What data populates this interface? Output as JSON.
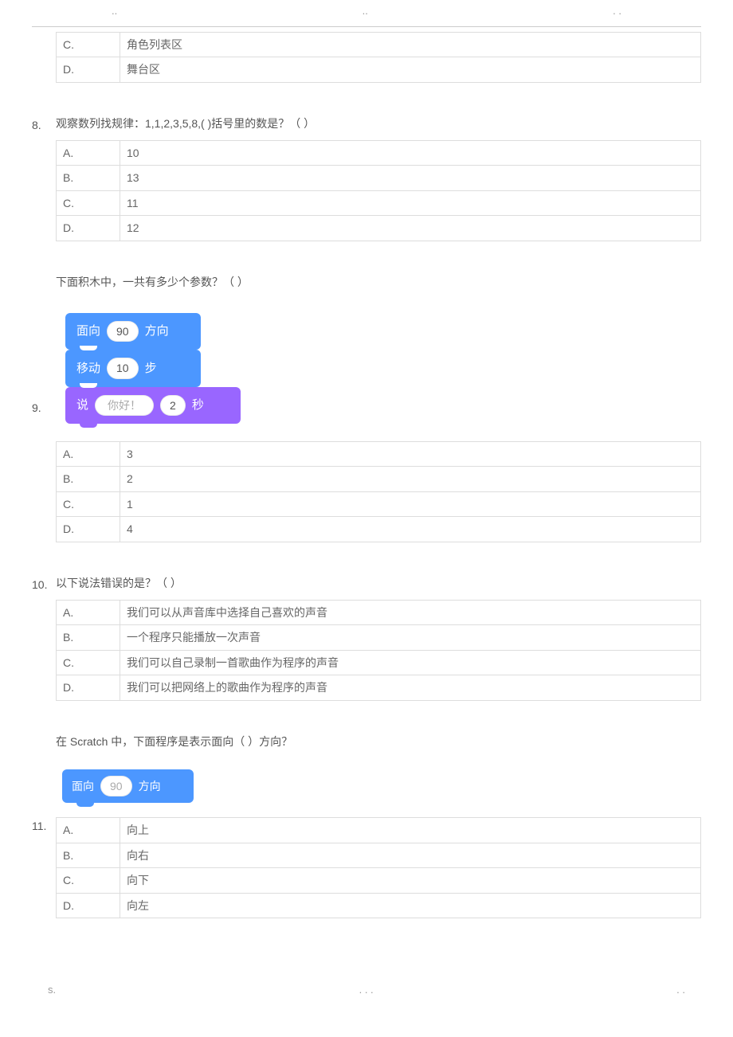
{
  "topdots": {
    "a": "..",
    "b": "..",
    "c": ". ."
  },
  "q7_tail": {
    "options": [
      {
        "letter": "C.",
        "text": "角色列表区"
      },
      {
        "letter": "D.",
        "text": "舞台区"
      }
    ]
  },
  "q8": {
    "num": "8.",
    "text": "观察数列找规律：1,1,2,3,5,8,( )括号里的数是？（  ）",
    "options": [
      {
        "letter": "A.",
        "text": "10"
      },
      {
        "letter": "B.",
        "text": "13"
      },
      {
        "letter": "C.",
        "text": "11"
      },
      {
        "letter": "D.",
        "text": "12"
      }
    ]
  },
  "q9": {
    "num": "9.",
    "text": "下面积木中，一共有多少个参数？（  ）",
    "block1_l": "面向",
    "block1_v": "90",
    "block1_r": "方向",
    "block2_l": "移动",
    "block2_v": "10",
    "block2_r": "步",
    "block3_l": "说",
    "block3_v1": "你好！",
    "block3_v2": "2",
    "block3_r": "秒",
    "options": [
      {
        "letter": "A.",
        "text": "3"
      },
      {
        "letter": "B.",
        "text": "2"
      },
      {
        "letter": "C.",
        "text": "1"
      },
      {
        "letter": "D.",
        "text": "4"
      }
    ]
  },
  "q10": {
    "num": "10.",
    "text": "以下说法错误的是？（  ）",
    "options": [
      {
        "letter": "A.",
        "text": "我们可以从声音库中选择自己喜欢的声音"
      },
      {
        "letter": "B.",
        "text": "一个程序只能播放一次声音"
      },
      {
        "letter": "C.",
        "text": "我们可以自己录制一首歌曲作为程序的声音"
      },
      {
        "letter": "D.",
        "text": "我们可以把网络上的歌曲作为程序的声音"
      }
    ]
  },
  "q11": {
    "num": "11.",
    "text": "在 Scratch 中，下面程序是表示面向（  ）方向？",
    "block_l": "面向",
    "block_v": "90",
    "block_r": "方向",
    "options": [
      {
        "letter": "A.",
        "text": "向上"
      },
      {
        "letter": "B.",
        "text": "向右"
      },
      {
        "letter": "C.",
        "text": "向下"
      },
      {
        "letter": "D.",
        "text": "向左"
      }
    ]
  },
  "footer": {
    "left": "s.",
    "mid": ". . .",
    "right": ". ."
  }
}
